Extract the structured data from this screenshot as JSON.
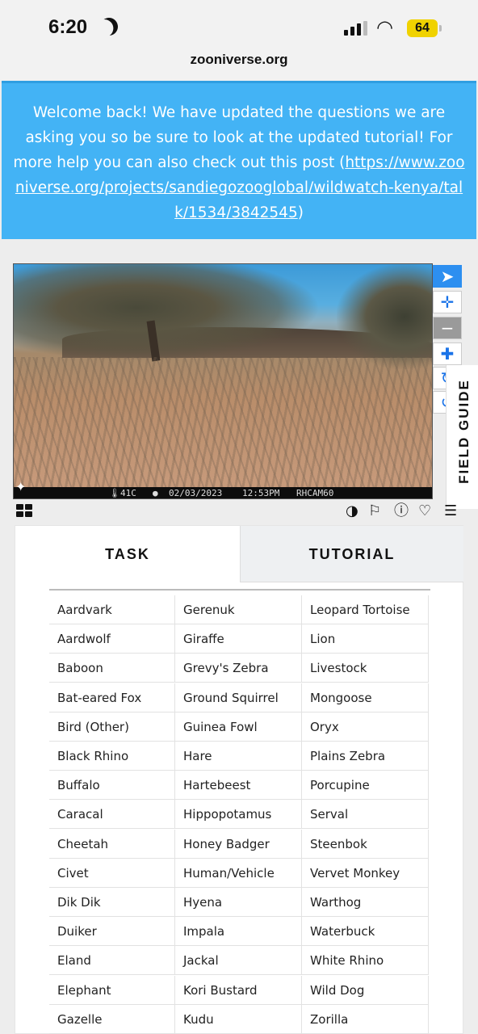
{
  "status_bar": {
    "time": "6:20",
    "battery": "64"
  },
  "browser": {
    "url": "zooniverse.org"
  },
  "banner": {
    "text_before": "Welcome back! We have updated the questions we are asking you so be sure to look at the updated tutorial! For more help you can also check out this post (",
    "link": "https://www.zooniverse.org/projects/sandiegozooglobal/wildwatch-kenya/talk/1534/3842545",
    "text_after": ")"
  },
  "camera_info": {
    "temperature": "41C",
    "date": "02/03/2023",
    "time": "12:53PM",
    "camera": "RHCAM60"
  },
  "viewer_tools": [
    "pointer-icon",
    "move-icon",
    "zoom-out-icon",
    "zoom-in-icon",
    "rotate-icon",
    "reset-icon"
  ],
  "field_guide": {
    "label": "FIELD GUIDE"
  },
  "tabs": {
    "task": "TASK",
    "tutorial": "TUTORIAL"
  },
  "choices": {
    "col1": [
      "Aardvark",
      "Aardwolf",
      "Baboon",
      "Bat-eared Fox",
      "Bird (Other)",
      "Black Rhino",
      "Buffalo",
      "Caracal",
      "Cheetah",
      "Civet",
      "Dik Dik",
      "Duiker",
      "Eland",
      "Elephant",
      "Gazelle"
    ],
    "col2": [
      "Gerenuk",
      "Giraffe",
      "Grevy's Zebra",
      "Ground Squirrel",
      "Guinea Fowl",
      "Hare",
      "Hartebeest",
      "Hippopotamus",
      "Honey Badger",
      "Human/Vehicle",
      "Hyena",
      "Impala",
      "Jackal",
      "Kori Bustard",
      "Kudu"
    ],
    "col3": [
      "Leopard Tortoise",
      "Lion",
      "Livestock",
      "Mongoose",
      "Oryx",
      "Plains Zebra",
      "Porcupine",
      "Serval",
      "Steenbok",
      "Vervet Monkey",
      "Warthog",
      "Waterbuck",
      "White Rhino",
      "Wild Dog",
      "Zorilla"
    ]
  },
  "colors": {
    "banner": "#43b3f5",
    "accent": "#2d8ff0"
  }
}
